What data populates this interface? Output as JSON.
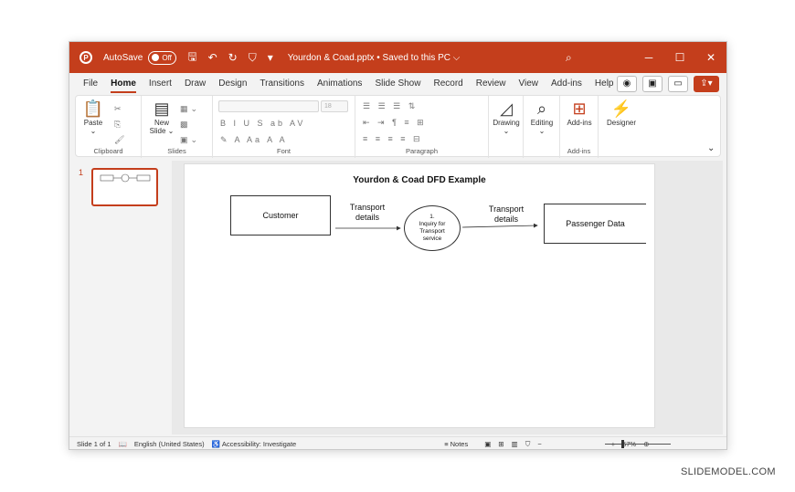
{
  "titlebar": {
    "autosave_label": "AutoSave",
    "autosave_state": "Off",
    "document_title": "Yourdon & Coad.pptx • Saved to this PC ⌵",
    "logo_letter": "P"
  },
  "menu": {
    "tabs": [
      "File",
      "Home",
      "Insert",
      "Draw",
      "Design",
      "Transitions",
      "Animations",
      "Slide Show",
      "Record",
      "Review",
      "View",
      "Add-ins",
      "Help"
    ],
    "active_tab": "Home"
  },
  "ribbon": {
    "clipboard": {
      "paste": "Paste",
      "label": "Clipboard"
    },
    "slides": {
      "new_slide": "New Slide",
      "label": "Slides"
    },
    "font": {
      "font_size": "18",
      "label": "Font"
    },
    "paragraph": {
      "label": "Paragraph"
    },
    "drawing": {
      "label": "Drawing"
    },
    "editing": {
      "label": "Editing"
    },
    "addins": {
      "button": "Add-ins",
      "label": "Add-ins"
    },
    "designer": {
      "label": "Designer"
    }
  },
  "thumbnails": [
    {
      "number": "1"
    }
  ],
  "slide": {
    "title": "Yourdon & Coad DFD Example",
    "customer": "Customer",
    "flow1": [
      "Transport",
      "details"
    ],
    "process": [
      "1.",
      "Inquiry for",
      "Transport",
      "service"
    ],
    "flow2": [
      "Transport",
      "details"
    ],
    "datastore": "Passenger Data"
  },
  "status": {
    "slide_info": "Slide 1 of 1",
    "language": "English (United States)",
    "accessibility": "Accessibility: Investigate",
    "notes": "Notes",
    "zoom": "57%"
  },
  "watermark": "SLIDEMODEL.COM",
  "colors": {
    "accent": "#c43e1c"
  }
}
